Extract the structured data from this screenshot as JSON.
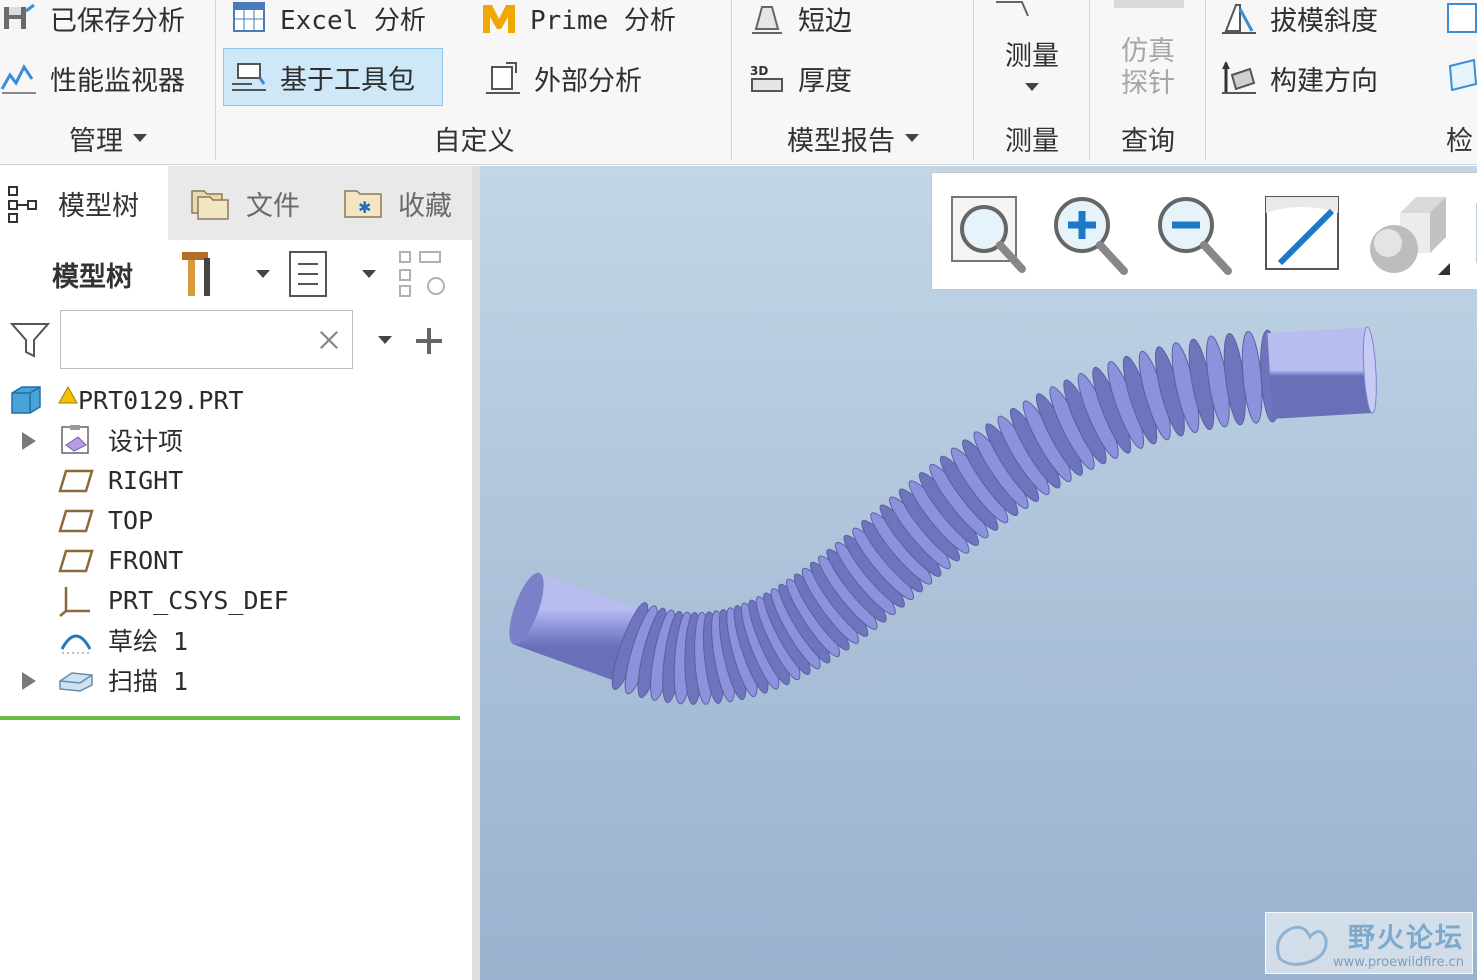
{
  "ribbon": {
    "group_manage": {
      "saved_analysis": "已保存分析",
      "performance_monitor": "性能监视器",
      "label": "管理"
    },
    "group_custom": {
      "excel_analysis": "Excel 分析",
      "prime_analysis": "Prime 分析",
      "toolkit_based": "基于工具包",
      "external_analysis": "外部分析",
      "label": "自定义"
    },
    "group_model_report": {
      "short_edge": "短边",
      "thickness": "厚度",
      "label": "模型报告"
    },
    "group_measure": {
      "measure_button": "测量",
      "label": "测量"
    },
    "group_query": {
      "simulation_probe_line1": "仿真",
      "simulation_probe_line2": "探针",
      "label": "查询"
    },
    "group_inspect": {
      "draft_angle": "拔模斜度",
      "build_direction": "构建方向",
      "label": "检"
    }
  },
  "panel": {
    "tabs": [
      {
        "label": "模型树"
      },
      {
        "label": "文件"
      },
      {
        "label": "收藏"
      }
    ],
    "tree_title": "模型树",
    "search": {
      "value": "",
      "placeholder": ""
    },
    "tree": [
      {
        "label": "PRT0129.PRT",
        "icon": "part-cube-icon"
      },
      {
        "label": "设计项",
        "icon": "design-items-icon",
        "expandable": true
      },
      {
        "label": "RIGHT",
        "icon": "datum-plane-icon"
      },
      {
        "label": "TOP",
        "icon": "datum-plane-icon"
      },
      {
        "label": "FRONT",
        "icon": "datum-plane-icon"
      },
      {
        "label": "PRT_CSYS_DEF",
        "icon": "coordinate-system-icon"
      },
      {
        "label": "草绘 1",
        "icon": "sketch-icon"
      },
      {
        "label": "扫描 1",
        "icon": "sweep-icon",
        "expandable": true
      }
    ]
  },
  "viewport": {
    "toolbar": [
      "refit-icon",
      "zoom-in-icon",
      "zoom-out-icon",
      "repaint-icon",
      "display-style-icon"
    ],
    "model_color": "#8c93dc",
    "watermark": {
      "title": "野火论坛",
      "url": "www.proewildfire.cn"
    }
  },
  "colors": {
    "accent_green": "#67bd48",
    "highlight_blue": "#cfe8f7"
  }
}
